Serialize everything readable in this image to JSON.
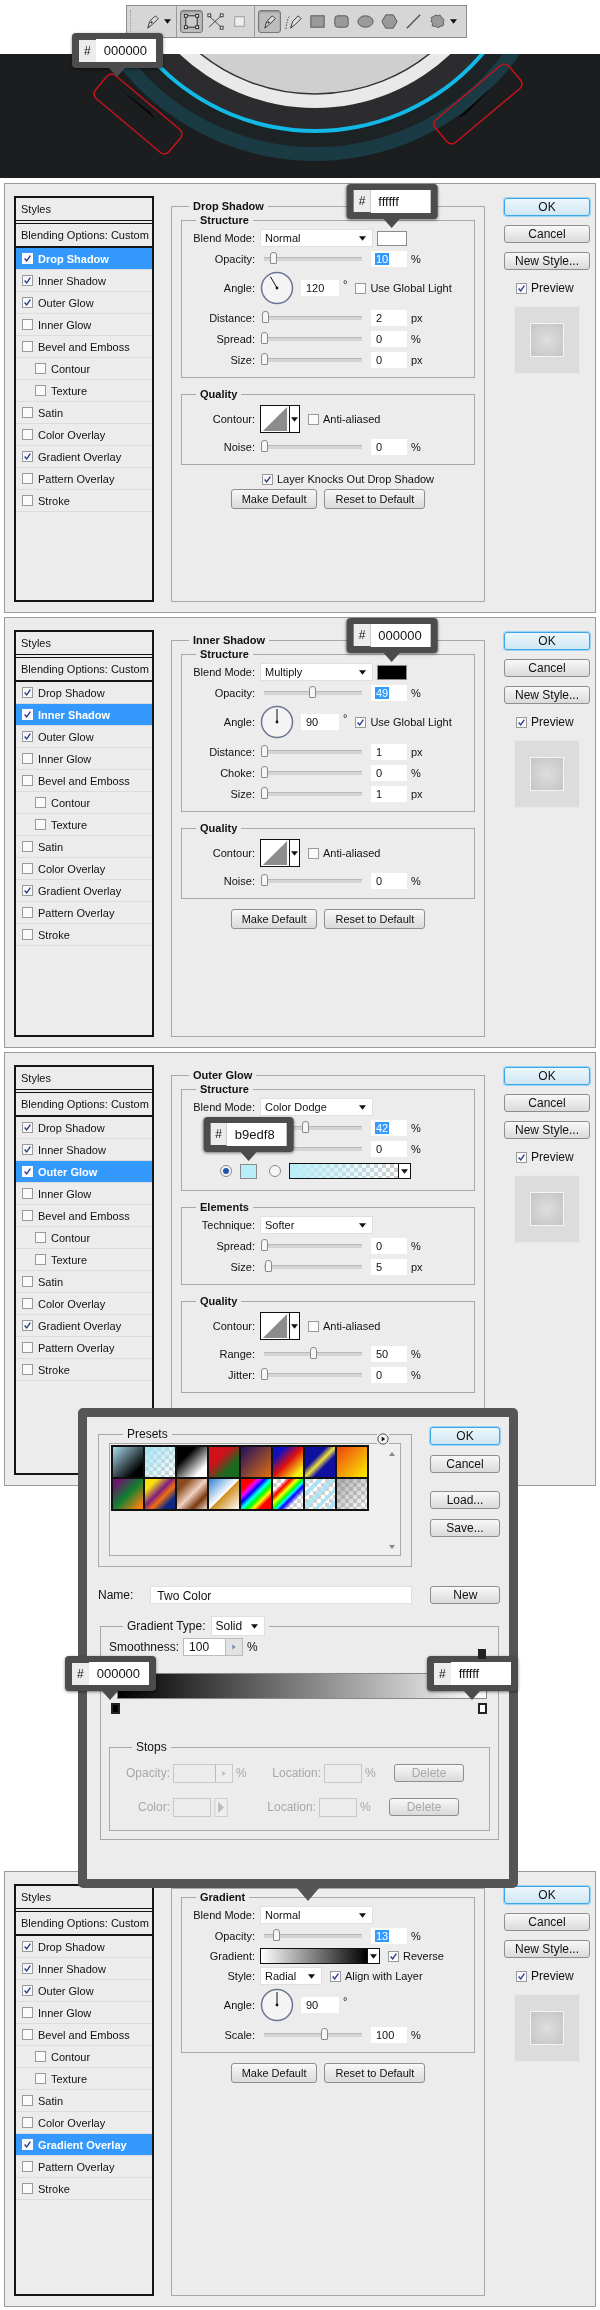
{
  "toolbar": {
    "modes": [
      {
        "kind": "shape-layers",
        "selected": true
      },
      {
        "kind": "paths",
        "selected": false
      },
      {
        "kind": "fill-pixels",
        "selected": false
      }
    ],
    "tools": [
      {
        "kind": "pen",
        "selected": true
      },
      {
        "kind": "freeform-pen",
        "selected": false
      },
      {
        "kind": "rectangle",
        "selected": false
      },
      {
        "kind": "rounded-rectangle",
        "selected": false
      },
      {
        "kind": "ellipse",
        "selected": false
      },
      {
        "kind": "polygon",
        "selected": false
      },
      {
        "kind": "line",
        "selected": false
      },
      {
        "kind": "custom-shape",
        "selected": false
      }
    ]
  },
  "canvas_callout": {
    "prefix": "#",
    "value": "000000"
  },
  "dialogs": [
    {
      "title": "Drop Shadow",
      "styles_heading": "Styles",
      "blending": "Blending Options: Custom",
      "styles": [
        {
          "label": "Drop Shadow",
          "checked": true,
          "selected": true
        },
        {
          "label": "Inner Shadow",
          "checked": true,
          "selected": false
        },
        {
          "label": "Outer Glow",
          "checked": true,
          "selected": false
        },
        {
          "label": "Inner Glow",
          "checked": false,
          "selected": false
        },
        {
          "label": "Bevel and Emboss",
          "checked": false,
          "selected": false,
          "children": [
            {
              "label": "Contour",
              "checked": false,
              "selected": false
            },
            {
              "label": "Texture",
              "checked": false,
              "selected": false
            }
          ]
        },
        {
          "label": "Satin",
          "checked": false,
          "selected": false
        },
        {
          "label": "Color Overlay",
          "checked": false,
          "selected": false
        },
        {
          "label": "Gradient Overlay",
          "checked": true,
          "selected": false
        },
        {
          "label": "Pattern Overlay",
          "checked": false,
          "selected": false
        },
        {
          "label": "Stroke",
          "checked": false,
          "selected": false
        }
      ],
      "groups": [
        {
          "title": "Structure",
          "rows": [
            {
              "kind": "select",
              "label": "Blend Mode:",
              "value": "Normal",
              "color": "#ffffff",
              "callout": {
                "prefix": "#",
                "value": "ffffff"
              }
            },
            {
              "kind": "slider",
              "label": "Opacity:",
              "level": 0.1,
              "value": "10",
              "unit": "%",
              "highlighted": true
            },
            {
              "kind": "angle",
              "label": "Angle:",
              "value": "120",
              "unit": "°",
              "check": {
                "label": "Use Global Light",
                "checked": false
              }
            },
            {
              "kind": "slider",
              "label": "Distance:",
              "level": 0.02,
              "value": "2",
              "unit": "px",
              "highlighted": false
            },
            {
              "kind": "slider",
              "label": "Spread:",
              "level": 0,
              "value": "0",
              "unit": "%",
              "highlighted": false
            },
            {
              "kind": "slider",
              "label": "Size:",
              "level": 0,
              "value": "0",
              "unit": "px",
              "highlighted": false
            }
          ]
        },
        {
          "title": "Quality",
          "rows": [
            {
              "kind": "contour",
              "label": "Contour:",
              "check": {
                "label": "Anti-aliased",
                "checked": false
              }
            },
            {
              "kind": "slider",
              "label": "Noise:",
              "level": 0,
              "value": "0",
              "unit": "%",
              "highlighted": false
            }
          ]
        }
      ],
      "knockout": {
        "label": "Layer Knocks Out Drop Shadow",
        "checked": true
      },
      "defaults": [
        "Make Default",
        "Reset to Default"
      ],
      "buttons": [
        "OK",
        "Cancel",
        "New Style..."
      ],
      "preview": {
        "label": "Preview",
        "checked": true
      }
    },
    {
      "title": "Inner Shadow",
      "styles_heading": "Styles",
      "blending": "Blending Options: Custom",
      "styles": [
        {
          "label": "Drop Shadow",
          "checked": true,
          "selected": false
        },
        {
          "label": "Inner Shadow",
          "checked": true,
          "selected": true
        },
        {
          "label": "Outer Glow",
          "checked": true,
          "selected": false
        },
        {
          "label": "Inner Glow",
          "checked": false,
          "selected": false
        },
        {
          "label": "Bevel and Emboss",
          "checked": false,
          "selected": false,
          "children": [
            {
              "label": "Contour",
              "checked": false,
              "selected": false
            },
            {
              "label": "Texture",
              "checked": false,
              "selected": false
            }
          ]
        },
        {
          "label": "Satin",
          "checked": false,
          "selected": false
        },
        {
          "label": "Color Overlay",
          "checked": false,
          "selected": false
        },
        {
          "label": "Gradient Overlay",
          "checked": true,
          "selected": false
        },
        {
          "label": "Pattern Overlay",
          "checked": false,
          "selected": false
        },
        {
          "label": "Stroke",
          "checked": false,
          "selected": false
        }
      ],
      "groups": [
        {
          "title": "Structure",
          "rows": [
            {
              "kind": "select",
              "label": "Blend Mode:",
              "value": "Multiply",
              "color": "#000000",
              "callout": {
                "prefix": "#",
                "value": "000000"
              }
            },
            {
              "kind": "slider",
              "label": "Opacity:",
              "level": 0.49,
              "value": "49",
              "unit": "%",
              "highlighted": true
            },
            {
              "kind": "angle",
              "label": "Angle:",
              "value": "90",
              "unit": "°",
              "check": {
                "label": "Use Global Light",
                "checked": true
              }
            },
            {
              "kind": "slider",
              "label": "Distance:",
              "level": 0.01,
              "value": "1",
              "unit": "px",
              "highlighted": false
            },
            {
              "kind": "slider",
              "label": "Choke:",
              "level": 0,
              "value": "0",
              "unit": "%",
              "highlighted": false
            },
            {
              "kind": "slider",
              "label": "Size:",
              "level": 0.01,
              "value": "1",
              "unit": "px",
              "highlighted": false
            }
          ]
        },
        {
          "title": "Quality",
          "rows": [
            {
              "kind": "contour",
              "label": "Contour:",
              "check": {
                "label": "Anti-aliased",
                "checked": false
              }
            },
            {
              "kind": "slider",
              "label": "Noise:",
              "level": 0,
              "value": "0",
              "unit": "%",
              "highlighted": false
            }
          ]
        }
      ],
      "defaults": [
        "Make Default",
        "Reset to Default"
      ],
      "buttons": [
        "OK",
        "Cancel",
        "New Style..."
      ],
      "preview": {
        "label": "Preview",
        "checked": true
      }
    },
    {
      "title": "Outer Glow",
      "styles_heading": "Styles",
      "blending": "Blending Options: Custom",
      "styles": [
        {
          "label": "Drop Shadow",
          "checked": true,
          "selected": false
        },
        {
          "label": "Inner Shadow",
          "checked": true,
          "selected": false
        },
        {
          "label": "Outer Glow",
          "checked": true,
          "selected": true
        },
        {
          "label": "Inner Glow",
          "checked": false,
          "selected": false
        },
        {
          "label": "Bevel and Emboss",
          "checked": false,
          "selected": false,
          "children": [
            {
              "label": "Contour",
              "checked": false,
              "selected": false
            },
            {
              "label": "Texture",
              "checked": false,
              "selected": false
            }
          ]
        },
        {
          "label": "Satin",
          "checked": false,
          "selected": false
        },
        {
          "label": "Color Overlay",
          "checked": false,
          "selected": false
        },
        {
          "label": "Gradient Overlay",
          "checked": true,
          "selected": false
        },
        {
          "label": "Pattern Overlay",
          "checked": false,
          "selected": false
        },
        {
          "label": "Stroke",
          "checked": false,
          "selected": false
        }
      ],
      "groups": [
        {
          "title": "Structure",
          "rows": [
            {
              "kind": "select",
              "label": "Blend Mode:",
              "value": "Color Dodge"
            },
            {
              "kind": "slider",
              "level": 0.42,
              "value": "42",
              "unit": "%",
              "highlighted": true
            },
            {
              "kind": "slider",
              "value": "0",
              "unit": "%",
              "highlighted": false
            },
            {
              "kind": "color-choice",
              "options": [
                {
                  "kind": "color",
                  "selected": true,
                  "color": "#b9edf8",
                  "callout": {
                    "prefix": "#",
                    "value": "b9edf8"
                  }
                },
                {
                  "kind": "gradient",
                  "selected": false,
                  "color": "#b9edf8"
                }
              ]
            }
          ]
        },
        {
          "title": "Elements",
          "rows": [
            {
              "kind": "select",
              "label": "Technique:",
              "value": "Softer"
            },
            {
              "kind": "slider",
              "label": "Spread:",
              "level": 0,
              "value": "0",
              "unit": "%",
              "highlighted": false
            },
            {
              "kind": "slider",
              "label": "Size:",
              "level": 0.05,
              "value": "5",
              "unit": "px",
              "highlighted": false
            }
          ]
        },
        {
          "title": "Quality",
          "rows": [
            {
              "kind": "contour",
              "label": "Contour:",
              "check": {
                "label": "Anti-aliased",
                "checked": false
              }
            },
            {
              "kind": "slider",
              "label": "Range:",
              "level": 0.5,
              "value": "50",
              "unit": "%",
              "highlighted": false
            },
            {
              "kind": "slider",
              "label": "Jitter:",
              "level": 0,
              "value": "0",
              "unit": "%",
              "highlighted": false
            }
          ]
        }
      ],
      "buttons": [
        "OK",
        "Cancel",
        "New Style..."
      ],
      "preview": {
        "label": "Preview",
        "checked": true
      }
    },
    {
      "styles_heading": "Styles",
      "blending": "Blending Options: Custom",
      "styles": [
        {
          "label": "Drop Shadow",
          "checked": true,
          "selected": false
        },
        {
          "label": "Inner Shadow",
          "checked": true,
          "selected": false
        },
        {
          "label": "Outer Glow",
          "checked": true,
          "selected": false
        },
        {
          "label": "Inner Glow",
          "checked": false,
          "selected": false
        },
        {
          "label": "Bevel and Emboss",
          "checked": false,
          "selected": false,
          "children": [
            {
              "label": "Contour",
              "checked": false,
              "selected": false
            },
            {
              "label": "Texture",
              "checked": false,
              "selected": false
            }
          ]
        },
        {
          "label": "Satin",
          "checked": false,
          "selected": false
        },
        {
          "label": "Color Overlay",
          "checked": false,
          "selected": false
        },
        {
          "label": "Gradient Overlay",
          "checked": true,
          "selected": true
        },
        {
          "label": "Pattern Overlay",
          "checked": false,
          "selected": false
        },
        {
          "label": "Stroke",
          "checked": false,
          "selected": false
        }
      ],
      "groups": [
        {
          "title": "Gradient",
          "rows": [
            {
              "kind": "select",
              "label": "Blend Mode:",
              "value": "Normal"
            },
            {
              "kind": "slider",
              "label": "Opacity:",
              "level": 0.13,
              "value": "13",
              "unit": "%",
              "highlighted": true
            },
            {
              "kind": "gradient",
              "label": "Gradient:",
              "check": {
                "label": "Reverse",
                "checked": true
              }
            },
            {
              "kind": "select",
              "label": "Style:",
              "value": "Radial",
              "check": {
                "label": "Align with Layer",
                "checked": true
              }
            },
            {
              "kind": "angle",
              "label": "Angle:",
              "value": "90",
              "unit": "°"
            },
            {
              "kind": "slider",
              "label": "Scale:",
              "level": 0.62,
              "value": "100",
              "unit": "%",
              "highlighted": false
            }
          ]
        }
      ],
      "defaults": [
        "Make Default",
        "Reset to Default"
      ],
      "buttons": [
        "OK",
        "Cancel",
        "New Style..."
      ],
      "preview": {
        "label": "Preview",
        "checked": true
      }
    }
  ],
  "gradient_editor": {
    "presets_title": "Presets",
    "buttons": [
      "OK",
      "Cancel",
      "Load...",
      "Save..."
    ],
    "name_label": "Name:",
    "name_value": "Two Color",
    "new_button": "New",
    "type_label": "Gradient Type:",
    "type_value": "Solid",
    "smoothness_label": "Smoothness:",
    "smoothness_value": "100",
    "smoothness_unit": "%",
    "stops": [
      {
        "color": "#000000",
        "callout": {
          "prefix": "#",
          "value": "000000"
        }
      },
      {
        "color": "#ffffff",
        "callout": {
          "prefix": "#",
          "value": "ffffff"
        }
      }
    ],
    "stops_title": "Stops",
    "stops_disabled": true,
    "stop_rows": [
      {
        "label": "Opacity:",
        "unit": "%",
        "location_label": "Location:",
        "location_unit": "%",
        "delete": "Delete"
      },
      {
        "label": "Color:",
        "location_label": "Location:",
        "location_unit": "%",
        "delete": "Delete"
      }
    ]
  }
}
